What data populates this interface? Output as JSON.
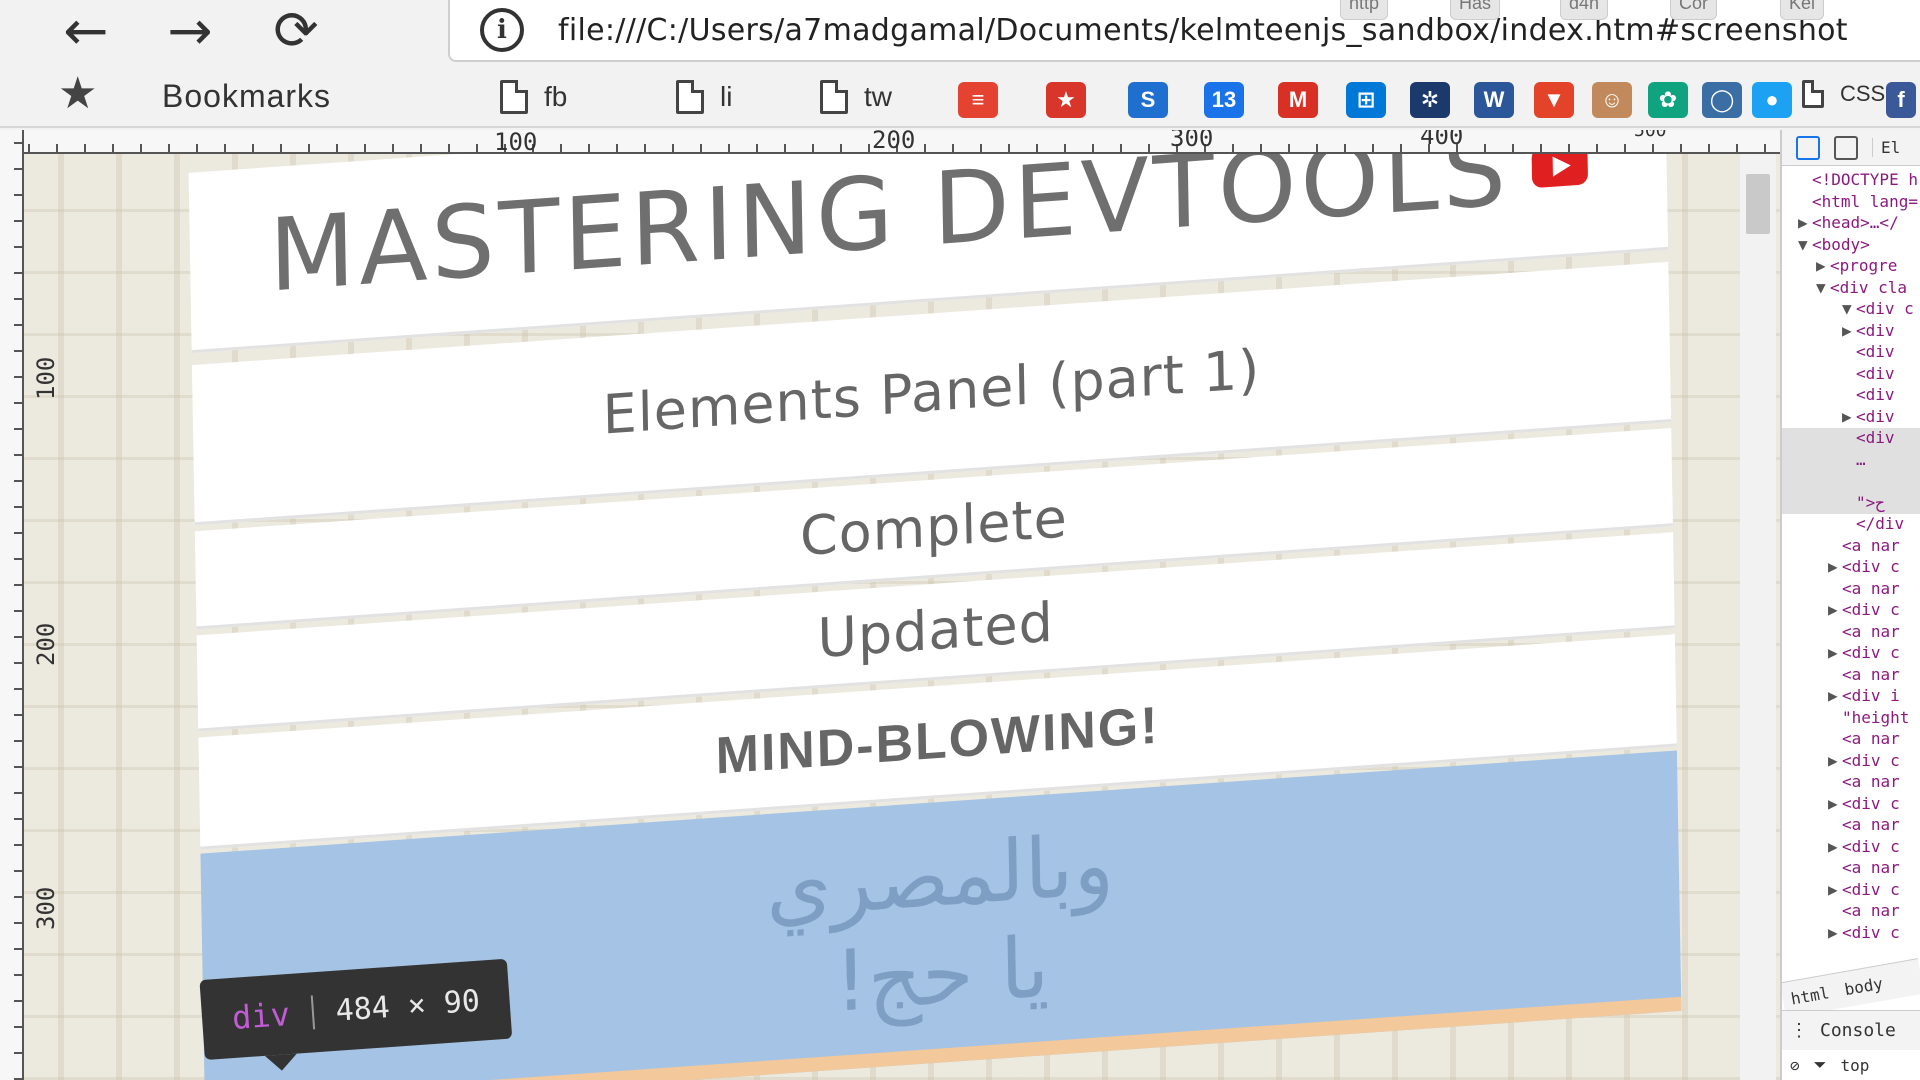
{
  "browser": {
    "nav": {
      "back": "←",
      "forward": "→",
      "reload": "⟳"
    },
    "url": "file:///C:/Users/a7madgamal/Documents/kelmteenjs_sandbox/index.htm#screenshot",
    "tabs": [
      "http",
      "Has",
      "d4n",
      "Cor",
      "Kel"
    ]
  },
  "bookmarks": {
    "title": "Bookmarks",
    "items": [
      {
        "label": "fb",
        "icon": "document-icon"
      },
      {
        "label": "li",
        "icon": "document-icon"
      },
      {
        "label": "tw",
        "icon": "document-icon"
      }
    ],
    "favicons": [
      {
        "name": "todoist-icon",
        "color": "#e44332",
        "glyph": "≡"
      },
      {
        "name": "star-app-icon",
        "color": "#d9362b",
        "glyph": "★"
      },
      {
        "name": "swirl-icon",
        "color": "#1f6fd1",
        "glyph": "S"
      },
      {
        "name": "calendar-icon",
        "color": "#1a73e8",
        "glyph": "13"
      },
      {
        "name": "gmail-icon",
        "color": "#d93025",
        "glyph": "M"
      },
      {
        "name": "windows-icon",
        "color": "#0078d7",
        "glyph": "⊞"
      },
      {
        "name": "tree-icon",
        "color": "#1b3a6b",
        "glyph": "✲"
      },
      {
        "name": "word-icon",
        "color": "#2b579a",
        "glyph": "W"
      },
      {
        "name": "gitlab-icon",
        "color": "#e24329",
        "glyph": "▼"
      },
      {
        "name": "avatar-icon",
        "color": "#c28a5c",
        "glyph": "☺"
      },
      {
        "name": "openai-icon",
        "color": "#10a37f",
        "glyph": "✿"
      },
      {
        "name": "chat-icon",
        "color": "#3a6ea5",
        "glyph": "◯"
      },
      {
        "name": "blue-dot-icon",
        "color": "#1da1f2",
        "glyph": "●"
      }
    ],
    "css_label": "CSS",
    "facebook_glyph": "f"
  },
  "rulers": {
    "top": [
      "100",
      "200",
      "300",
      "400",
      "500"
    ],
    "left": [
      "100",
      "200",
      "300"
    ]
  },
  "page": {
    "title": "MASTERING DEVTOOLS",
    "subtitle": "Elements Panel (part 1)",
    "line2": "Complete",
    "line3": "Updated",
    "line4": "MIND-BLOWING!",
    "arabic_line1": "وبالمصري",
    "arabic_line2": "يا حج!",
    "tooltip": {
      "tag": "div",
      "size": "484 × 90"
    },
    "colors": {
      "highlight": "#a5c3e4",
      "margin": "#f3c89a",
      "youtube": "#e02020"
    }
  },
  "devtools": {
    "tab": "El",
    "lines": [
      {
        "arrow": "",
        "text": "<!DOCTYPE h"
      },
      {
        "arrow": "",
        "text": "<html lang="
      },
      {
        "arrow": "▶",
        "text": "<head>…</"
      },
      {
        "arrow": "▼",
        "text": "<body>"
      },
      {
        "arrow": "▶",
        "text": "<progre"
      },
      {
        "arrow": "▼",
        "text": "<div cla"
      },
      {
        "arrow": "▼",
        "text": "<div c"
      },
      {
        "arrow": "▶",
        "text": "<div"
      },
      {
        "arrow": "",
        "text": "<div"
      },
      {
        "arrow": "",
        "text": "<div"
      },
      {
        "arrow": "",
        "text": "<div"
      },
      {
        "arrow": "▶",
        "text": "<div"
      },
      {
        "arrow": "",
        "text": "<div"
      },
      {
        "arrow": "",
        "text": "…"
      },
      {
        "arrow": "",
        "text": ""
      },
      {
        "arrow": "",
        "text": "\">ح"
      },
      {
        "arrow": "",
        "text": "</div"
      },
      {
        "arrow": "",
        "text": "<a nar"
      },
      {
        "arrow": "▶",
        "text": "<div c"
      },
      {
        "arrow": "",
        "text": "<a nar"
      },
      {
        "arrow": "▶",
        "text": "<div c"
      },
      {
        "arrow": "",
        "text": "<a nar"
      },
      {
        "arrow": "▶",
        "text": "<div c"
      },
      {
        "arrow": "",
        "text": "<a nar"
      },
      {
        "arrow": "▶",
        "text": "<div i"
      },
      {
        "arrow": "",
        "text": "\"height"
      },
      {
        "arrow": "",
        "text": "<a nar"
      },
      {
        "arrow": "▶",
        "text": "<div c"
      },
      {
        "arrow": "",
        "text": "<a nar"
      },
      {
        "arrow": "▶",
        "text": "<div c"
      },
      {
        "arrow": "",
        "text": "<a nar"
      },
      {
        "arrow": "▶",
        "text": "<div c"
      },
      {
        "arrow": "",
        "text": "<a nar"
      },
      {
        "arrow": "▶",
        "text": "<div c"
      },
      {
        "arrow": "",
        "text": "<a nar"
      },
      {
        "arrow": "▶",
        "text": "<div c"
      }
    ],
    "crumbs": [
      "html",
      "body"
    ],
    "console_label": "Console",
    "context_label": "top"
  }
}
